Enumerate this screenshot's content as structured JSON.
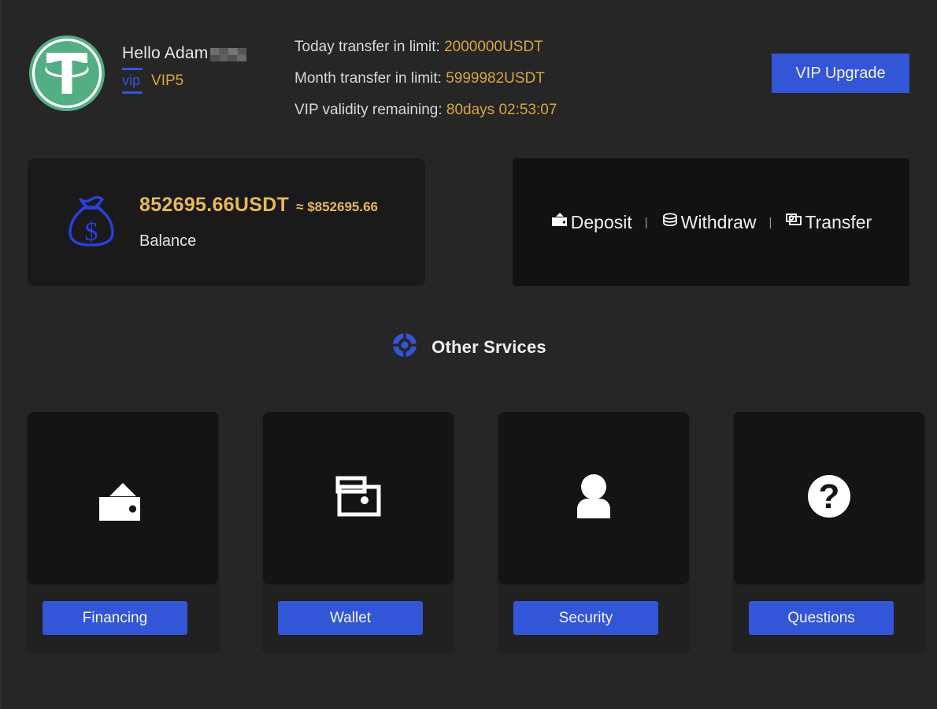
{
  "theme": {
    "page_bg": "#262626",
    "card_bg": "#1a1a1a",
    "panel_bg": "#121212",
    "accent_blue": "#3355d8",
    "accent_gold": "#d9a441",
    "tether_green": "#53ae84",
    "text_primary": "#e8e8e8"
  },
  "header": {
    "logo_icon": "tether-logo-icon",
    "greeting": "Hello Adam",
    "greeting_redacted": true,
    "vip_tag": "vip",
    "vip_level": "VIP5",
    "limits": [
      {
        "label": "Today transfer in limit:",
        "value": "2000000USDT"
      },
      {
        "label": "Month transfer in limit:",
        "value": "5999982USDT"
      },
      {
        "label": "VIP validity remaining:",
        "value": "80days 02:53:07"
      }
    ],
    "vip_upgrade_label": "VIP Upgrade"
  },
  "balance": {
    "icon": "money-bag-icon",
    "amount": "852695.66USDT",
    "approx": "≈ $852695.66",
    "label": "Balance"
  },
  "actions": {
    "separator": "|",
    "items": [
      {
        "label": "Deposit",
        "icon": "wallet-deposit-icon"
      },
      {
        "label": "Withdraw",
        "icon": "coin-stack-icon"
      },
      {
        "label": "Transfer",
        "icon": "transfer-cards-icon"
      }
    ]
  },
  "services": {
    "section_icon": "target-donut-icon",
    "section_title": "Other Srvices",
    "cards": [
      {
        "label": "Financing",
        "icon": "wallet-filled-icon"
      },
      {
        "label": "Wallet",
        "icon": "wallet-outline-icon"
      },
      {
        "label": "Security",
        "icon": "user-person-icon"
      },
      {
        "label": "Questions",
        "icon": "question-mark-circle-icon"
      }
    ]
  }
}
